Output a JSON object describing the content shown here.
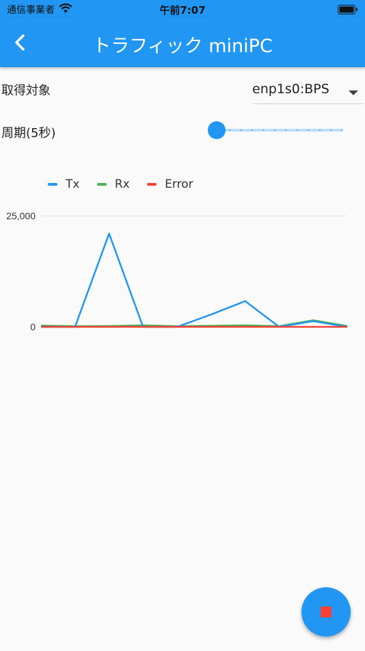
{
  "status_bar": {
    "carrier": "通信事業者",
    "time": "午前7:07"
  },
  "app_bar": {
    "title": "トラフィック miniPC"
  },
  "target": {
    "label": "取得対象",
    "selected": "enp1s0:BPS"
  },
  "period": {
    "label": "周期(5秒)",
    "slider_value": 0,
    "slider_steps": 10
  },
  "colors": {
    "primary": "#2196f3",
    "tx": "#2196f3",
    "rx": "#4caf50",
    "error": "#f44336",
    "stop": "#f44336"
  },
  "chart_data": {
    "type": "line",
    "x": [
      0,
      1,
      2,
      3,
      4,
      5,
      6,
      7,
      8,
      9
    ],
    "ylim": [
      0,
      25000
    ],
    "yticks": [
      "25,000",
      "0"
    ],
    "legend_position": "top-left",
    "series": [
      {
        "name": "Tx",
        "values": [
          0,
          0,
          21000,
          0,
          0,
          2800,
          5800,
          0,
          1300,
          0
        ]
      },
      {
        "name": "Rx",
        "values": [
          300,
          150,
          200,
          350,
          150,
          250,
          350,
          150,
          1500,
          200
        ]
      },
      {
        "name": "Error",
        "values": [
          0,
          0,
          0,
          0,
          0,
          0,
          0,
          0,
          0,
          0
        ]
      }
    ]
  }
}
